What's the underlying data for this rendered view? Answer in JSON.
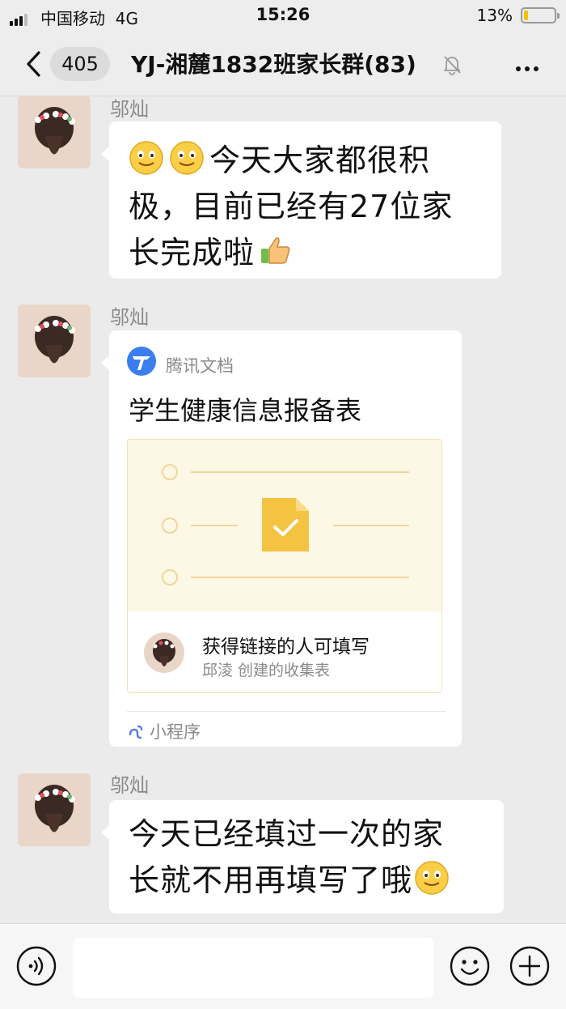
{
  "status_bar": {
    "carrier": "中国移动",
    "network": "4G",
    "time": "15:26",
    "battery_percent": "13%",
    "battery_level": 0.13
  },
  "nav": {
    "unread_count": "405",
    "title": "YJ-湘麓1832班家长群(83)"
  },
  "messages": [
    {
      "sender": "邬灿",
      "type": "text",
      "line1": "今天大家都很积",
      "line2": "极，目前已经有27位家",
      "line3": "长完成啦"
    },
    {
      "sender": "邬灿",
      "type": "mini_program_card",
      "source": "腾讯文档",
      "title": "学生健康信息报备表",
      "permission": "获得链接的人可填写",
      "creator": "邱淩 创建的收集表",
      "footer": "小程序"
    },
    {
      "sender": "邬灿",
      "type": "text",
      "line1": "今天已经填过一次的家",
      "line2": "长就不用再填写了哦"
    }
  ],
  "colors": {
    "background": "#ebebeb",
    "bubble": "#ffffff",
    "accent_doc": "#f5c342",
    "tencent_blue": "#3a7ef0"
  }
}
